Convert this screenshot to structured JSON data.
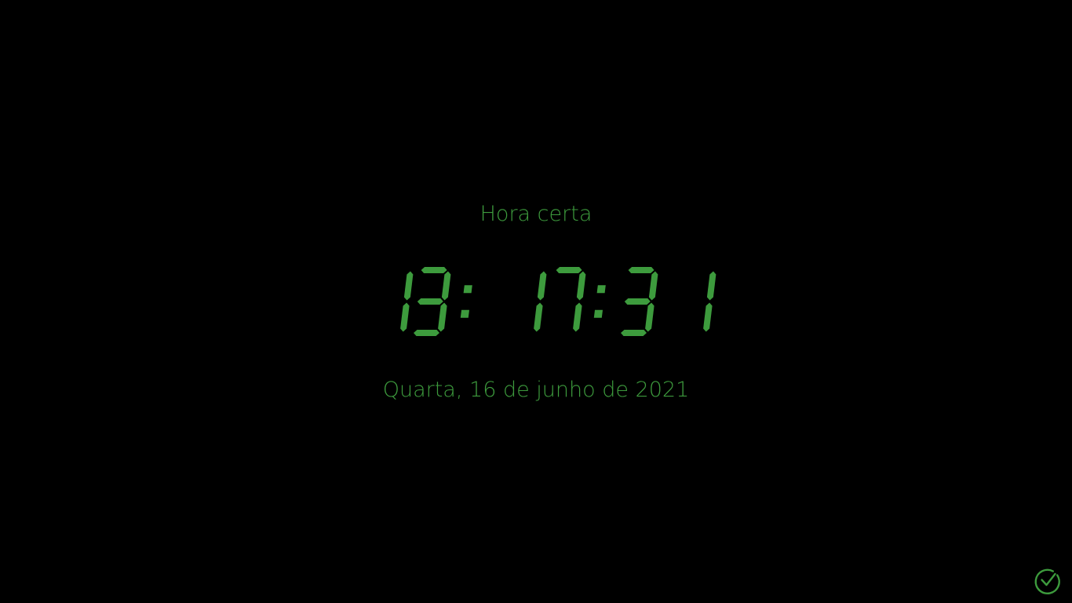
{
  "colors": {
    "background": "#000000",
    "accent": "#3d9b3d"
  },
  "heading": "Hora certa",
  "time": {
    "text": "13: 17:31",
    "hours": "13",
    "minutes": "17",
    "seconds": "31"
  },
  "date": "Quarta, 16 de junho de 2021",
  "icons": {
    "status": "check-circle-icon"
  }
}
